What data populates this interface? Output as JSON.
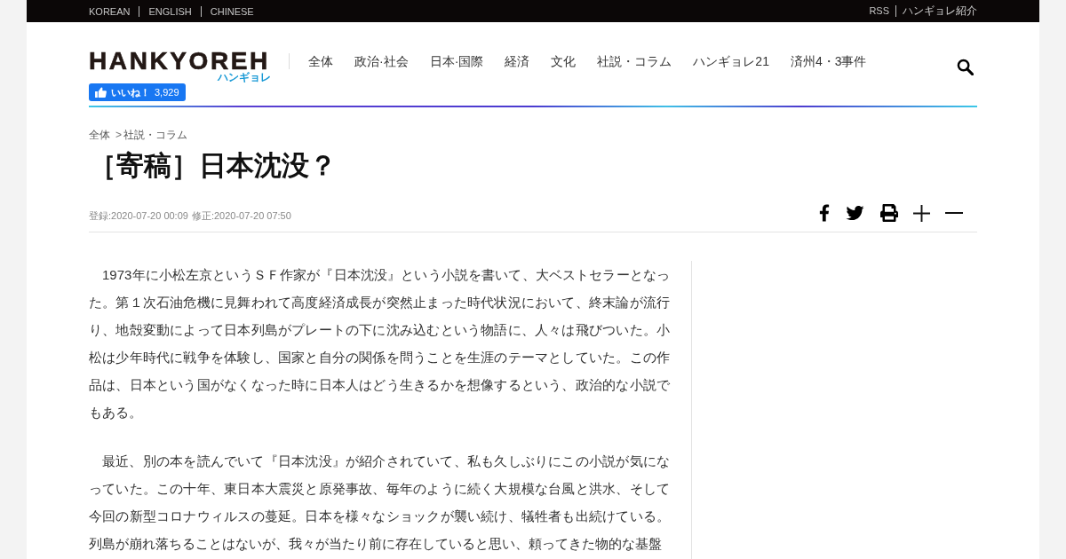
{
  "top_bar": {
    "languages": [
      {
        "label": "KOREAN"
      },
      {
        "label": "ENGLISH"
      },
      {
        "label": "CHINESE"
      }
    ],
    "links": [
      {
        "label": "RSS"
      },
      {
        "label": "ハンギョレ紹介"
      }
    ]
  },
  "header": {
    "logo": {
      "wordmark": "HANKYOREH",
      "subtitle": "ハンギョレ"
    },
    "like_button": {
      "label": "いいね！",
      "count": "3,929"
    },
    "nav": [
      {
        "label": "全体"
      },
      {
        "label": "政治·社会"
      },
      {
        "label": "日本·国際"
      },
      {
        "label": "経済"
      },
      {
        "label": "文化"
      },
      {
        "label": "社説・コラム"
      },
      {
        "label": "ハンギョレ21"
      },
      {
        "label": "済州4・3事件"
      }
    ]
  },
  "article": {
    "breadcrumb": {
      "items": [
        "全体",
        "社説・コラム"
      ],
      "separator": ">"
    },
    "title": "［寄稿］日本沈没？",
    "dates": [
      "登録:2020-07-20 00:09",
      "修正:2020-07-20 07:50"
    ],
    "share_tools": [
      {
        "kind": "facebook"
      },
      {
        "kind": "twitter"
      },
      {
        "kind": "print"
      },
      {
        "kind": "font_larger"
      },
      {
        "kind": "font_smaller"
      }
    ],
    "paragraphs": [
      "1973年に小松左京というＳＦ作家が『日本沈没』という小説を書いて、大ベストセラーとなった。第１次石油危機に見舞われて高度経済成長が突然止まった時代状況において、終末論が流行り、地殻変動によって日本列島がプレートの下に沈み込むという物語に、人々は飛びついた。小松は少年時代に戦争を体験し、国家と自分の関係を問うことを生涯のテーマとしていた。この作品は、日本という国がなくなった時に日本人はどう生きるかを想像するという、政治的な小説でもある。",
      "最近、別の本を読んでいて『日本沈没』が紹介されていて、私も久しぶりにこの小説が気になっていた。この十年、東日本大震災と原発事故、毎年のように続く大規模な台風と洪水、そして今回の新型コロナウィルスの蔓延。日本を様々なショックが襲い続け、犠牲者も出続けている。列島が崩れ落ちることはないが、我々が当たり前に存在していると思い、頼ってきた物的な基盤"
    ]
  }
}
